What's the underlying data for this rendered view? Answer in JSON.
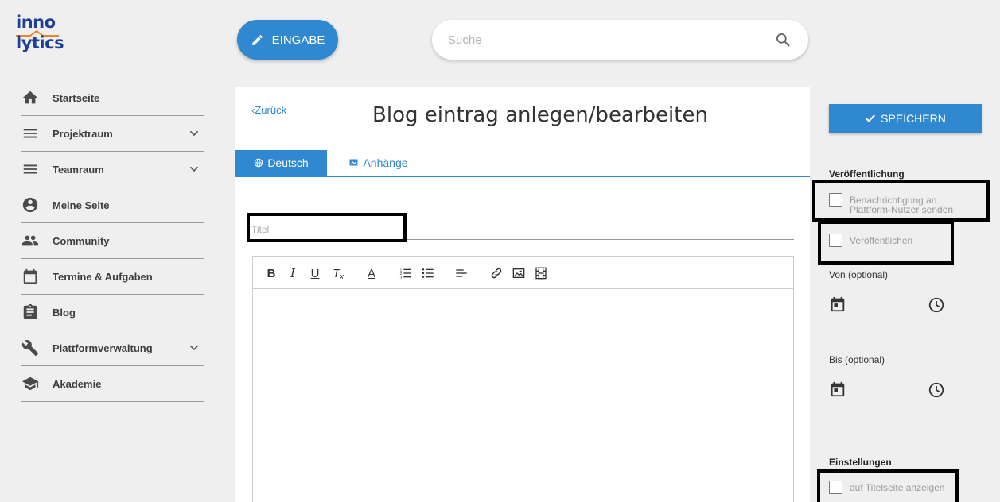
{
  "logo": {
    "line1": "inno",
    "line2": "lytics"
  },
  "header": {
    "eingabe_label": "EINGABE",
    "search_placeholder": "Suche"
  },
  "sidebar": {
    "items": [
      {
        "label": "Startseite",
        "icon": "home-icon",
        "expandable": false
      },
      {
        "label": "Projektraum",
        "icon": "menu-icon",
        "expandable": true
      },
      {
        "label": "Teamraum",
        "icon": "menu-icon",
        "expandable": true
      },
      {
        "label": "Meine Seite",
        "icon": "account-circle-icon",
        "expandable": false
      },
      {
        "label": "Community",
        "icon": "people-icon",
        "expandable": false
      },
      {
        "label": "Termine & Aufgaben",
        "icon": "calendar-icon",
        "expandable": false
      },
      {
        "label": "Blog",
        "icon": "clipboard-icon",
        "expandable": false
      },
      {
        "label": "Plattformverwaltung",
        "icon": "wrench-icon",
        "expandable": true
      },
      {
        "label": "Akademie",
        "icon": "graduation-cap-icon",
        "expandable": false
      }
    ]
  },
  "main": {
    "back_label": "Zurück",
    "title": "Blog eintrag anlegen/bearbeiten",
    "tabs": [
      {
        "label": "Deutsch",
        "active": true
      },
      {
        "label": "Anhänge",
        "active": false
      }
    ],
    "title_placeholder": "Titel",
    "toolbar": {
      "bold": "B",
      "italic": "I",
      "underline": "U",
      "clear_format": "T",
      "text_color": "A"
    }
  },
  "right": {
    "save_label": "SPEICHERN",
    "publish_heading": "Veröffentlichung",
    "notify_label": "Benachrichtigung an Plattform-Nutzer senden",
    "publish_label": "Veröffentlichen",
    "from_label": "Von (optional)",
    "to_label": "Bis (optional)",
    "settings_heading": "Einstellungen",
    "frontpage_label": "auf Titelseite anzeigen"
  },
  "colors": {
    "accent": "#2f88d0",
    "logo_blue": "#1e3f94",
    "logo_orange": "#e8862a"
  }
}
